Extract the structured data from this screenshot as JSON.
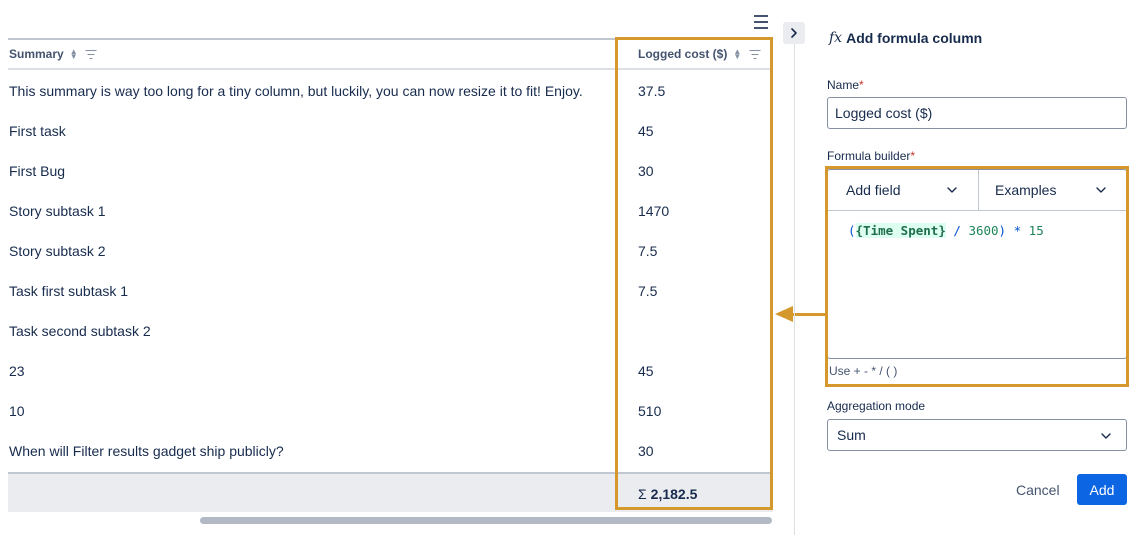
{
  "table": {
    "columns": {
      "summary": "Summary",
      "cost": "Logged cost ($)"
    },
    "rows": [
      {
        "summary": "This summary is way too long for a tiny column, but luckily, you can now resize it to fit! Enjoy.",
        "cost": "37.5"
      },
      {
        "summary": "First task",
        "cost": "45"
      },
      {
        "summary": "First Bug",
        "cost": "30"
      },
      {
        "summary": "Story subtask 1",
        "cost": "1470"
      },
      {
        "summary": "Story subtask 2",
        "cost": "7.5"
      },
      {
        "summary": "Task first subtask 1",
        "cost": "7.5"
      },
      {
        "summary": "Task second subtask 2",
        "cost": ""
      },
      {
        "summary": "23",
        "cost": "45"
      },
      {
        "summary": "10",
        "cost": "510"
      },
      {
        "summary": "When will Filter results gadget ship publicly?",
        "cost": "30"
      }
    ],
    "total_symbol": "Σ",
    "total_value": "2,182.5"
  },
  "panel": {
    "title": "Add formula column",
    "fx_symbol": "fx",
    "name_label": "Name",
    "required_mark": "*",
    "name_value": "Logged cost ($)",
    "formula_label": "Formula builder",
    "add_field_label": "Add field",
    "examples_label": "Examples",
    "formula": {
      "open_paren": "(",
      "field": "{Time Spent}",
      "divide": "/",
      "divisor": "3600",
      "close_paren": ")",
      "multiply": "*",
      "multiplier": "15"
    },
    "hint": "Use + - * / ( )",
    "aggregation_label": "Aggregation mode",
    "aggregation_value": "Sum",
    "cancel_label": "Cancel",
    "add_label": "Add"
  },
  "colors": {
    "highlight": "#d4982c",
    "primary": "#0c66e4"
  },
  "icons": [
    "menu-icon",
    "sort-icon",
    "filter-icon",
    "chevron-right-icon",
    "chevron-down-icon",
    "fx-icon",
    "arrow-left-icon"
  ]
}
